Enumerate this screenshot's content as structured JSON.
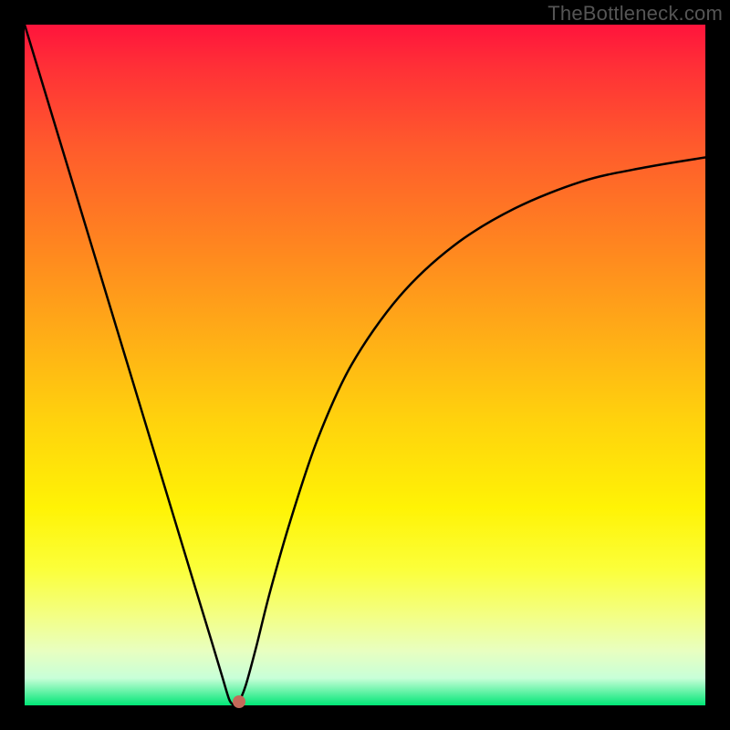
{
  "watermark": "TheBottleneck.com",
  "chart_data": {
    "type": "line",
    "title": "",
    "xlabel": "",
    "ylabel": "",
    "xlim": [
      0,
      1
    ],
    "ylim": [
      0,
      1
    ],
    "series": [
      {
        "name": "curve",
        "x": [
          0.0,
          0.05,
          0.1,
          0.15,
          0.2,
          0.25,
          0.275,
          0.29,
          0.3,
          0.305,
          0.31,
          0.315,
          0.325,
          0.34,
          0.36,
          0.39,
          0.43,
          0.48,
          0.55,
          0.63,
          0.72,
          0.82,
          0.91,
          1.0
        ],
        "y": [
          1.0,
          0.835,
          0.67,
          0.505,
          0.34,
          0.175,
          0.093,
          0.043,
          0.01,
          0.002,
          0.0,
          0.005,
          0.03,
          0.085,
          0.165,
          0.27,
          0.39,
          0.5,
          0.6,
          0.675,
          0.73,
          0.77,
          0.79,
          0.805
        ]
      }
    ],
    "marker": {
      "x": 0.315,
      "y": 0.005,
      "color": "#c46a5a"
    },
    "background_gradient": {
      "stops": [
        {
          "pos": 0.0,
          "color": "#ff143c"
        },
        {
          "pos": 0.5,
          "color": "#ffd20d"
        },
        {
          "pos": 0.8,
          "color": "#fbff3a"
        },
        {
          "pos": 1.0,
          "color": "#00e676"
        }
      ]
    }
  }
}
